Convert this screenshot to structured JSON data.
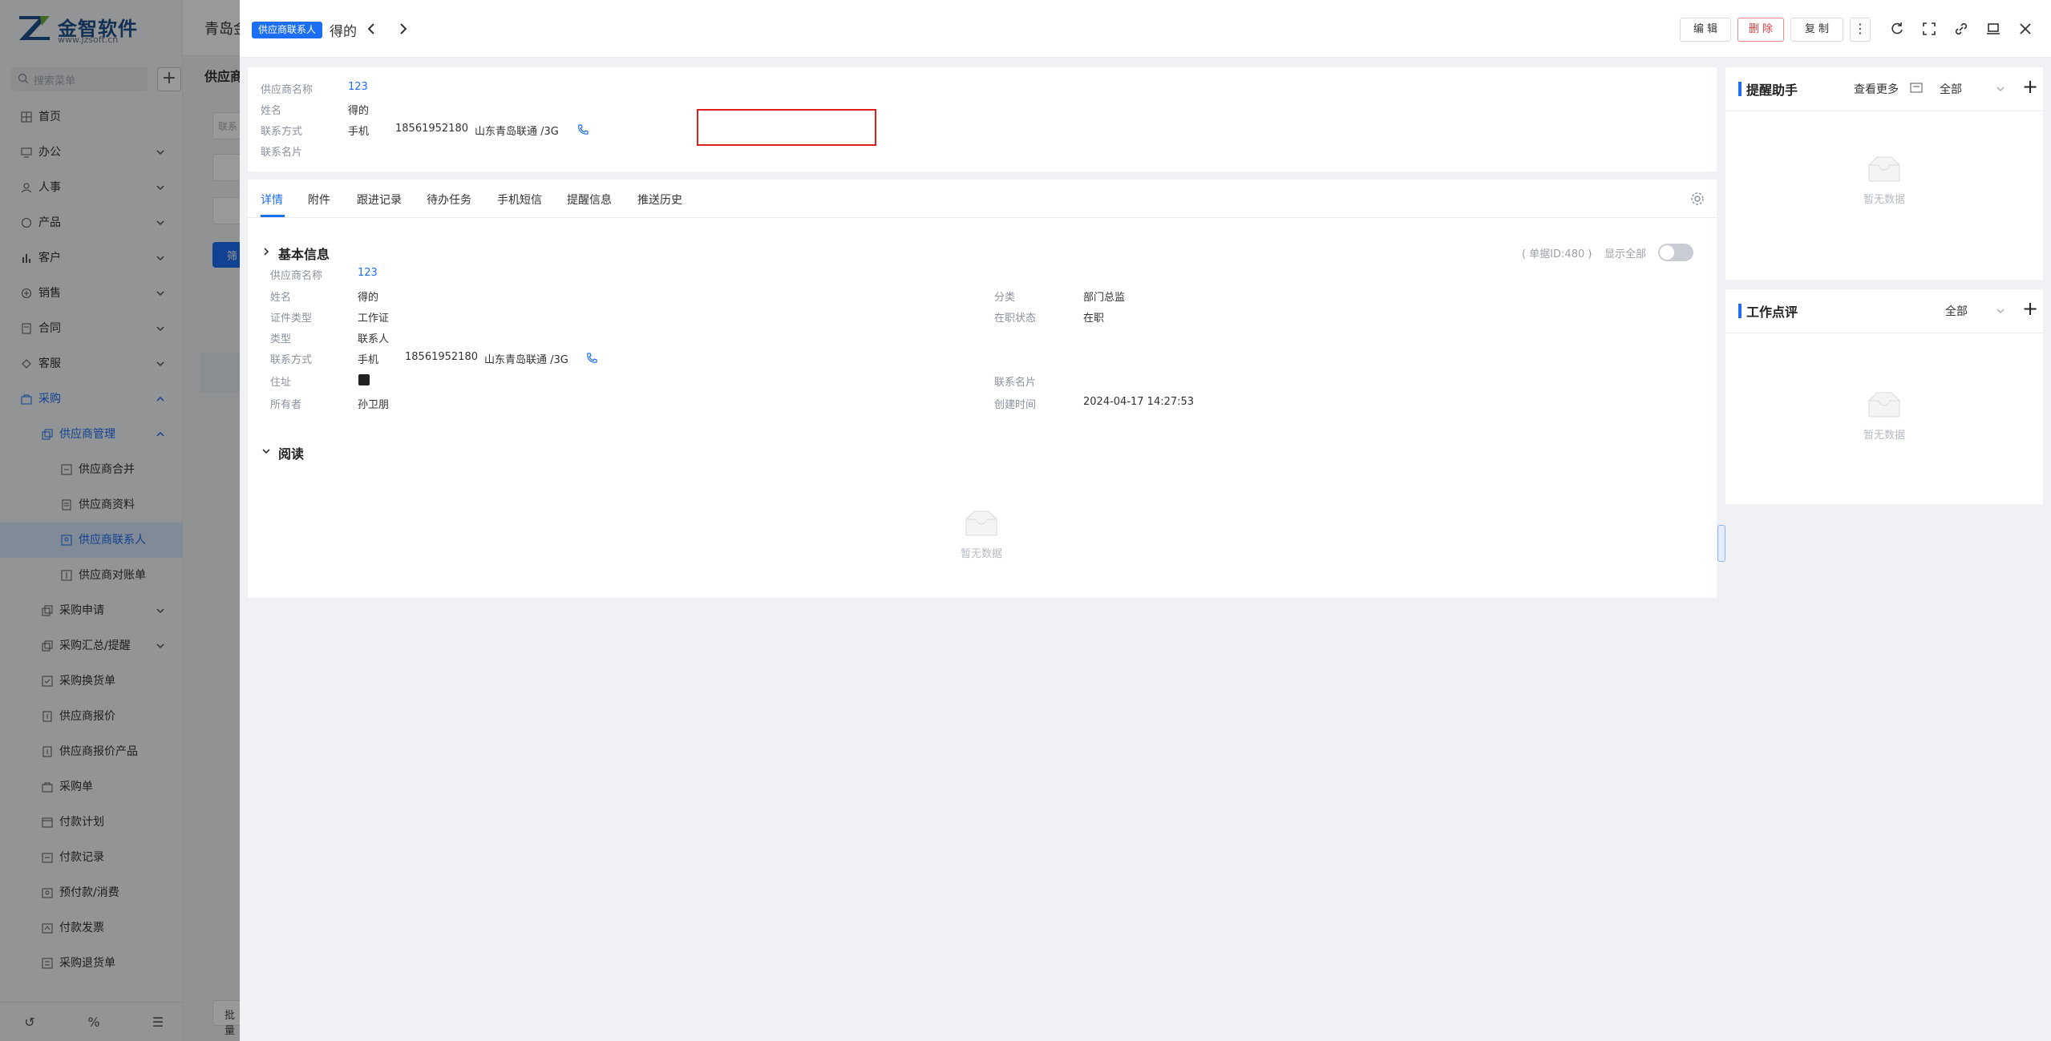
{
  "app": {
    "logo_title": "金智软件",
    "logo_sub": "www.jzsoft.cn",
    "search_placeholder": "搜索菜单",
    "top_title": "青岛金",
    "sub_title": "供应商",
    "bg_field_text": "联系",
    "bg_button": "筛",
    "bg_batch": "批量"
  },
  "sidebar": {
    "items": [
      {
        "label": "首页",
        "icon": "grid-icon"
      },
      {
        "label": "办公",
        "icon": "desk-icon"
      },
      {
        "label": "人事",
        "icon": "people-icon"
      },
      {
        "label": "产品",
        "icon": "product-icon"
      },
      {
        "label": "客户",
        "icon": "chart-icon"
      },
      {
        "label": "销售",
        "icon": "sales-icon"
      },
      {
        "label": "合同",
        "icon": "contract-icon"
      },
      {
        "label": "客服",
        "icon": "service-icon"
      },
      {
        "label": "采购",
        "icon": "purchase-icon"
      },
      {
        "label": "供应商管理",
        "icon": "copy-icon"
      },
      {
        "label": "供应商合并",
        "icon": "merge-icon"
      },
      {
        "label": "供应商资料",
        "icon": "doc-icon"
      },
      {
        "label": "供应商联系人",
        "icon": "contact-icon"
      },
      {
        "label": "供应商对账单",
        "icon": "bill-icon"
      },
      {
        "label": "采购申请",
        "icon": "copy-icon"
      },
      {
        "label": "采购汇总/提醒",
        "icon": "copy-icon"
      },
      {
        "label": "采购换货单",
        "icon": "swap-icon"
      },
      {
        "label": "供应商报价",
        "icon": "quote-icon"
      },
      {
        "label": "供应商报价产品",
        "icon": "quote-icon"
      },
      {
        "label": "采购单",
        "icon": "order-icon"
      },
      {
        "label": "付款计划",
        "icon": "plan-icon"
      },
      {
        "label": "付款记录",
        "icon": "record-icon"
      },
      {
        "label": "预付款/消费",
        "icon": "prepay-icon"
      },
      {
        "label": "付款发票",
        "icon": "invoice-icon"
      },
      {
        "label": "采购退货单",
        "icon": "return-icon"
      }
    ],
    "bottom_icons": [
      "history-icon",
      "percent-icon",
      "menu-icon"
    ]
  },
  "drawer": {
    "badge": "供应商联系人",
    "title": "得的",
    "buttons": {
      "edit": "编 辑",
      "delete": "删 除",
      "copy": "复 制"
    },
    "summary": {
      "supplier_label": "供应商名称",
      "supplier_value": "123",
      "name_label": "姓名",
      "name_value": "得的",
      "contact_label": "联系方式",
      "contact_type": "手机",
      "phone": "18561952180",
      "carrier": "山东青岛联通 /3G",
      "card_label": "联系名片"
    },
    "tabs": [
      "详情",
      "附件",
      "跟进记录",
      "待办任务",
      "手机短信",
      "提醒信息",
      "推送历史"
    ],
    "basic": {
      "title": "基本信息",
      "doc_id": "( 单据ID:480 )",
      "show_all": "显示全部",
      "rows": {
        "supplier_label": "供应商名称",
        "supplier_value": "123",
        "name_label": "姓名",
        "name_value": "得的",
        "category_label": "分类",
        "category_value": "部门总监",
        "id_type_label": "证件类型",
        "id_type_value": "工作证",
        "status_label": "在职状态",
        "status_value": "在职",
        "type_label": "类型",
        "type_value": "联系人",
        "contact_label": "联系方式",
        "contact_type": "手机",
        "phone": "18561952180",
        "carrier": "山东青岛联通 /3G",
        "address_label": "住址",
        "card_label": "联系名片",
        "owner_label": "所有者",
        "owner_value": "孙卫朋",
        "created_label": "创建时间",
        "created_value": "2024-04-17 14:27:53"
      }
    },
    "read": {
      "title": "阅读",
      "empty": "暂无数据"
    },
    "reminder": {
      "title": "提醒助手",
      "more": "查看更多",
      "filter": "全部",
      "empty": "暂无数据"
    },
    "review": {
      "title": "工作点评",
      "filter": "全部",
      "empty": "暂无数据"
    }
  }
}
